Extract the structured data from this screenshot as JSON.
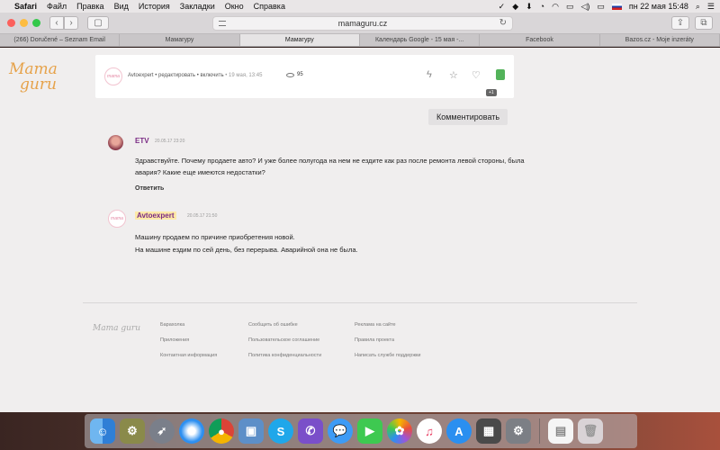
{
  "menubar": {
    "app": "Safari",
    "items": [
      "Файл",
      "Правка",
      "Вид",
      "История",
      "Закладки",
      "Окно",
      "Справка"
    ],
    "datetime": "пн 22 мая  15:48"
  },
  "browser": {
    "address": "mamaguru.cz",
    "tabs": [
      {
        "label": "(266) Doručené – Seznam Email"
      },
      {
        "label": "Мамагуру"
      },
      {
        "label": "Мамагуру",
        "active": true
      },
      {
        "label": "Календарь Google - 15 мая -..."
      },
      {
        "label": "Facebook"
      },
      {
        "label": "Bazos.cz - Moje inzeráty"
      }
    ]
  },
  "page": {
    "logo_line1": "Mama",
    "logo_line2": "guru",
    "post": {
      "author": "Avtoexpert",
      "actions": " • редактировать • включить",
      "date": " • 19 мая, 13:45",
      "views": "95",
      "badge": "+1"
    },
    "comment_button": "Комментировать",
    "comments": [
      {
        "author": "ETV",
        "time": "20.05.17 23:20",
        "text": "Здравствуйте. Почему продаете авто? И уже более полугода на нем не ездите как раз после ремонта левой стороны, была авария? Какие еще имеются недостатки?",
        "reply": "Ответить"
      },
      {
        "author": "Avtoexpert",
        "time": "20.05.17 21:50",
        "text_line1": "Машину продаем по причине приобретения новой.",
        "text_line2": "На машине ездим по сей день, без перерыва. Аварийной она не была."
      }
    ],
    "footer": {
      "logo": "Mama guru",
      "col1": [
        "Барахолка",
        "Приложения",
        "Контактная информация"
      ],
      "col2": [
        "Сообщить об ошибке",
        "Пользовательское соглашение",
        "Политика конфиденциальности"
      ],
      "col3": [
        "Реклама на сайте",
        "Правила проекта",
        "Написать службе поддержки"
      ]
    }
  },
  "dock": {
    "apps": [
      "finder",
      "taskman",
      "launchpad",
      "safari",
      "chrome",
      "preview",
      "skype",
      "viber",
      "messages",
      "facetime",
      "photos",
      "music",
      "app-store",
      "calculator",
      "system-preferences",
      "document",
      "trash"
    ]
  }
}
